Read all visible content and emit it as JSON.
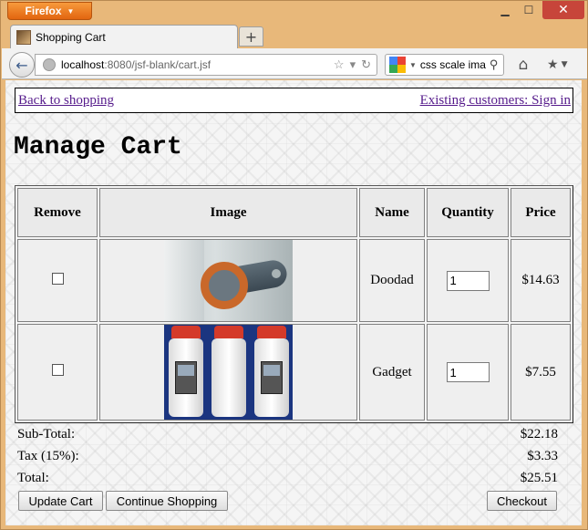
{
  "browser": {
    "app_button": "Firefox",
    "tab_title": "Shopping Cart",
    "url_host": "localhost",
    "url_rest": ":8080/jsf-blank/cart.jsf",
    "search_text": "css scale imag"
  },
  "page": {
    "back_link": "Back to shopping",
    "signin_link": "Existing customers: Sign in",
    "title": "Manage Cart"
  },
  "table": {
    "headers": [
      "Remove",
      "Image",
      "Name",
      "Quantity",
      "Price"
    ],
    "rows": [
      {
        "name": "Doodad",
        "quantity": "1",
        "price": "$14.63"
      },
      {
        "name": "Gadget",
        "quantity": "1",
        "price": "$7.55"
      }
    ]
  },
  "summary": {
    "subtotal_label": "Sub-Total:",
    "subtotal_value": "$22.18",
    "tax_label": "Tax (15%):",
    "tax_value": "$3.33",
    "total_label": "Total:",
    "total_value": "$25.51"
  },
  "buttons": {
    "update": "Update Cart",
    "continue": "Continue Shopping",
    "checkout": "Checkout"
  },
  "colors": {
    "frame": "#e8b87a",
    "firefox_button": "#e2650f",
    "close_button": "#c7453a",
    "visited_link": "#551a8b"
  }
}
